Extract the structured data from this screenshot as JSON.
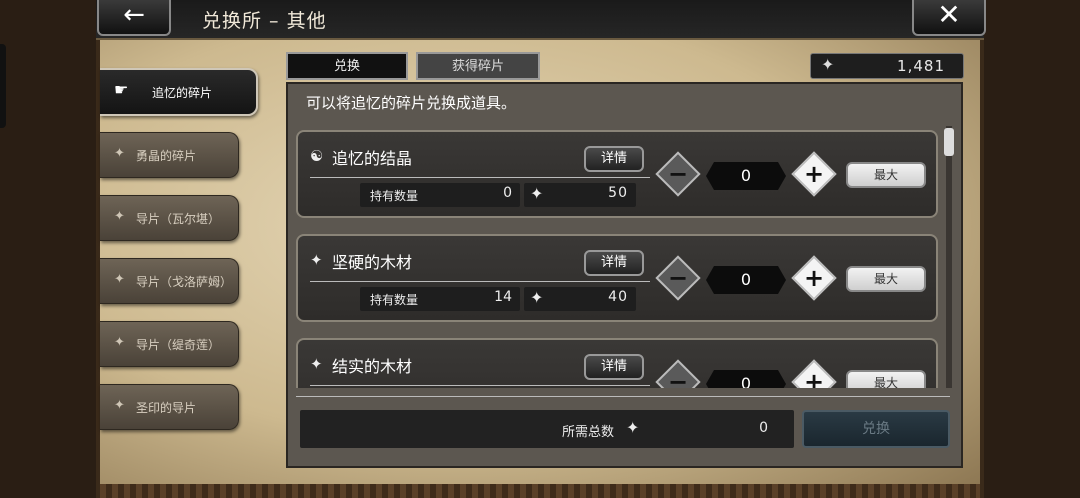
{
  "header": {
    "title": "兑换所 – 其他",
    "back_icon": "←",
    "close_icon": "✕"
  },
  "currency": {
    "icon": "✦",
    "value": "1,481"
  },
  "sidebar": {
    "items": [
      {
        "label": "追忆的碎片",
        "icon": "☛",
        "active": true
      },
      {
        "label": "勇晶的碎片",
        "icon": "✦",
        "active": false
      },
      {
        "label": "导片（瓦尔堪）",
        "icon": "✦",
        "active": false
      },
      {
        "label": "导片（戈洛萨姆）",
        "icon": "✦",
        "active": false
      },
      {
        "label": "导片（缇奇莲）",
        "icon": "✦",
        "active": false
      },
      {
        "label": "圣印的导片",
        "icon": "✦",
        "active": false
      }
    ]
  },
  "tabs": [
    {
      "label": "兑换"
    },
    {
      "label": "获得碎片"
    }
  ],
  "description": "可以将追忆的碎片兑换成道具。",
  "items": [
    {
      "name": "追忆的结晶",
      "icon": "☯",
      "detail_label": "详情",
      "held_label": "持有数量",
      "held": "0",
      "cost_icon": "✦",
      "cost": "50",
      "qty": "0",
      "max_label": "最大"
    },
    {
      "name": "坚硬的木材",
      "icon": "✦",
      "detail_label": "详情",
      "held_label": "持有数量",
      "held": "14",
      "cost_icon": "✦",
      "cost": "40",
      "qty": "0",
      "max_label": "最大"
    },
    {
      "name": "结实的木材",
      "icon": "✦",
      "detail_label": "详情",
      "held_label": "持有数量",
      "held": "",
      "cost_icon": "✦",
      "cost": "",
      "qty": "0",
      "max_label": "最大"
    }
  ],
  "buttons": {
    "minus": "−",
    "plus": "+"
  },
  "footer": {
    "total_label": "所需总数",
    "total_icon": "✦",
    "total_value": "0",
    "exchange_label": "兑换"
  }
}
